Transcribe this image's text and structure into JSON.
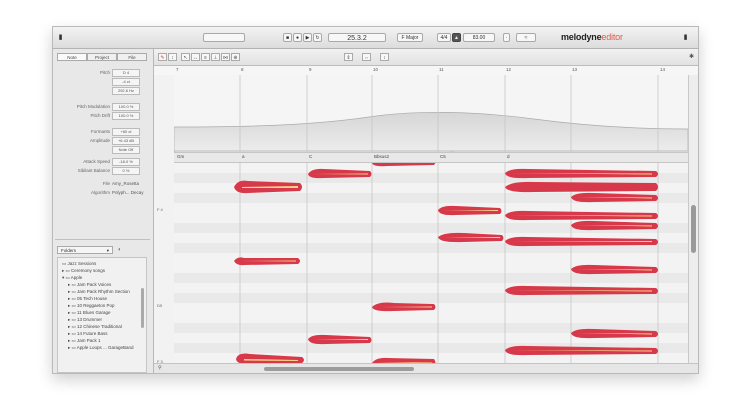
{
  "colors": {
    "blob_outer": "#d8394a",
    "blob_inner": "#f4d78a",
    "accent": "#e35a4a"
  },
  "transport": {
    "position": "25.3.2",
    "key": "F Major",
    "time_sig": "4/4",
    "tempo": "83.00",
    "buttons": [
      "stop-icon",
      "record-icon",
      "play-icon",
      "cycle-icon"
    ]
  },
  "app": {
    "logo_main": "melodyne",
    "logo_edition": "editor"
  },
  "inspector": {
    "tabs": [
      "Note",
      "Project",
      "File"
    ],
    "properties": [
      {
        "label": "Pitch",
        "value": "D 4"
      },
      {
        "label": "",
        "value": "-4 ct"
      },
      {
        "label": "",
        "value": "292.6 Hz"
      },
      {
        "label": "Pitch Modulation",
        "value": "100.0 %"
      },
      {
        "label": "Pitch Drift",
        "value": "100.0 %"
      },
      {
        "label": "Formants",
        "value": "+60 ct"
      },
      {
        "label": "Amplitude",
        "value": "+6.43 dB"
      },
      {
        "label": "",
        "value": "Note Off"
      },
      {
        "label": "Attack Speed",
        "value": "-18.0 %"
      },
      {
        "label": "Sibilant Balance",
        "value": "0 %"
      }
    ],
    "file_label": "File",
    "file_value": "Amy_Rosetta",
    "algorithm_label": "Algorithm",
    "algorithm_value": "Polyph... Decay"
  },
  "browser": {
    "dropdown": "Folders",
    "items": [
      "Jazz Sessions",
      "Ceremony songs",
      "Apple",
      "Jam Pack Voices",
      "Jam Pack Rhythm Section",
      "05 Tech House",
      "10 Reggaeton Pop",
      "11 Blues Garage",
      "13 Drummer",
      "12 Chinese Traditional",
      "14 Future Bass",
      "Jam Pack 1",
      "Apple Loops ... GarageBand"
    ]
  },
  "ruler": {
    "bars": [
      "7",
      "8",
      "9",
      "10",
      "11",
      "12",
      "13",
      "14"
    ]
  },
  "chords": [
    "Gm",
    "a",
    "C",
    "Bbsus2",
    "C5",
    "d"
  ],
  "pitch_labels": [
    "F 4",
    "D5",
    "F 3"
  ]
}
